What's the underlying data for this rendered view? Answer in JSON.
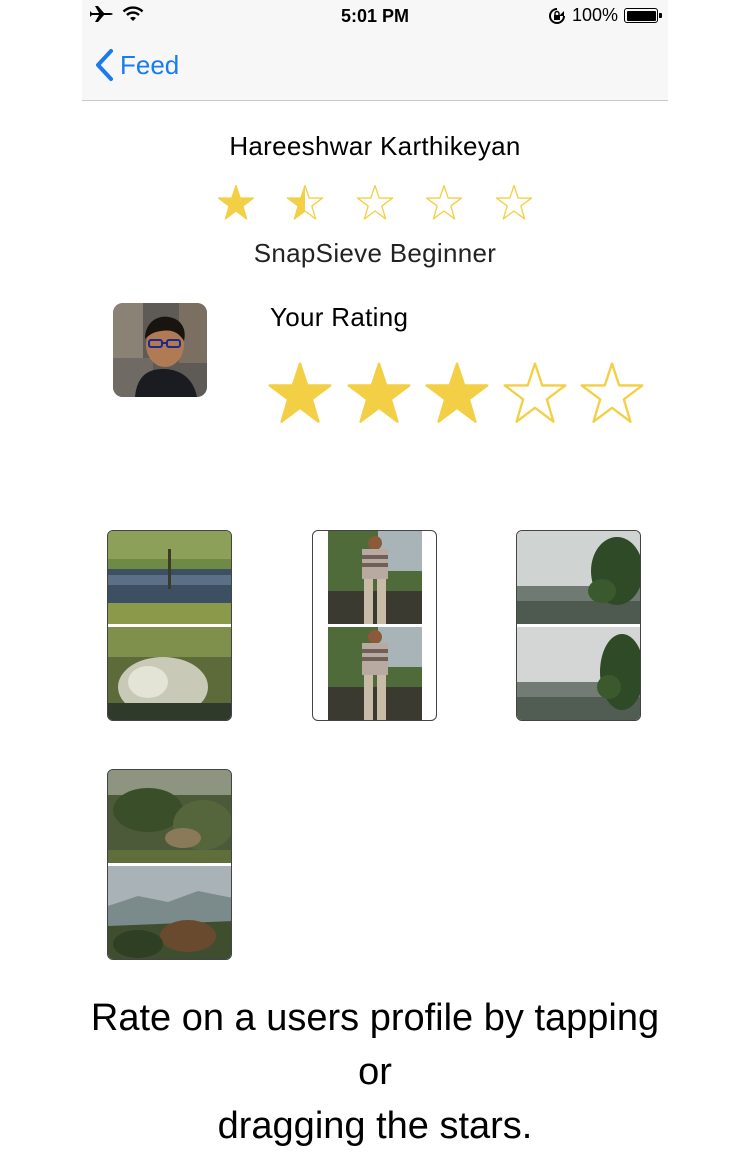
{
  "status_bar": {
    "time": "5:01 PM",
    "battery_text": "100%",
    "battery_level": 1.0,
    "icons": [
      "airplane-icon",
      "wifi-icon",
      "rotation-lock-icon",
      "battery-icon"
    ]
  },
  "nav": {
    "back_label": "Feed",
    "back_icon": "chevron-left-icon",
    "accent": "#1a7bf0"
  },
  "profile": {
    "name": "Hareeshwar Karthikeyan",
    "user_rating": 1.5,
    "rank": "SnapSieve Beginner",
    "avatar_icon": "avatar"
  },
  "your_rating": {
    "label": "Your Rating",
    "value": 3,
    "max": 5
  },
  "photos": [
    {
      "name": "photo-lake-marsh"
    },
    {
      "name": "photo-man-on-railing"
    },
    {
      "name": "photo-misty-valley-tree"
    },
    {
      "name": "photo-forest-slope"
    }
  ],
  "hint": {
    "line1": "Rate on a users profile by tapping",
    "line2": "or",
    "line3": "dragging the stars."
  },
  "colors": {
    "star": "#f3cf45",
    "star_outline": "#f3cf45"
  }
}
